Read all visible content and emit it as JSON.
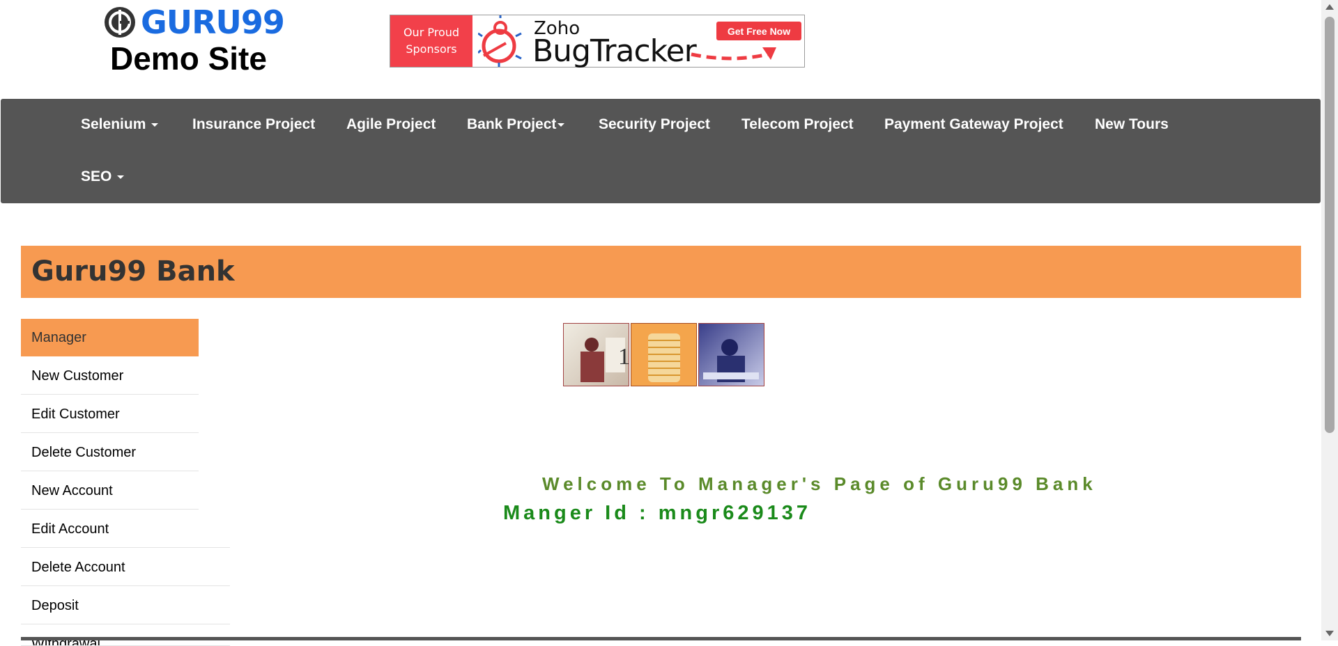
{
  "logo": {
    "word": "GURU99",
    "subtitle": "Demo Site"
  },
  "banner": {
    "left_line1": "Our Proud",
    "left_line2": "Sponsors",
    "brand_small": "Zoho",
    "brand_large": "BugTracker",
    "cta": "Get Free Now"
  },
  "nav": {
    "items": [
      {
        "label": "Selenium",
        "dropdown": true
      },
      {
        "label": "Insurance Project",
        "dropdown": false
      },
      {
        "label": "Agile Project",
        "dropdown": false
      },
      {
        "label": "Bank Project",
        "dropdown": true
      },
      {
        "label": "Security Project",
        "dropdown": false
      },
      {
        "label": "Telecom Project",
        "dropdown": false
      },
      {
        "label": "Payment Gateway Project",
        "dropdown": false
      },
      {
        "label": "New Tours",
        "dropdown": false
      },
      {
        "label": "SEO",
        "dropdown": true
      }
    ]
  },
  "title": "Guru99 Bank",
  "menu": {
    "items": [
      "Manager",
      "New Customer",
      "Edit Customer",
      "Delete Customer",
      "New Account",
      "Edit Account",
      "Delete Account",
      "Deposit",
      "Withdrawal"
    ]
  },
  "welcome": "Welcome To Manager's Page of Guru99 Bank",
  "manager_id": "Manger Id : mngr629137",
  "colors": {
    "accent": "#f79a51",
    "navbar": "#555555",
    "logo_blue": "#1a6be0",
    "welcome_green": "#5a8a2a",
    "id_green": "#1a8a1a"
  }
}
